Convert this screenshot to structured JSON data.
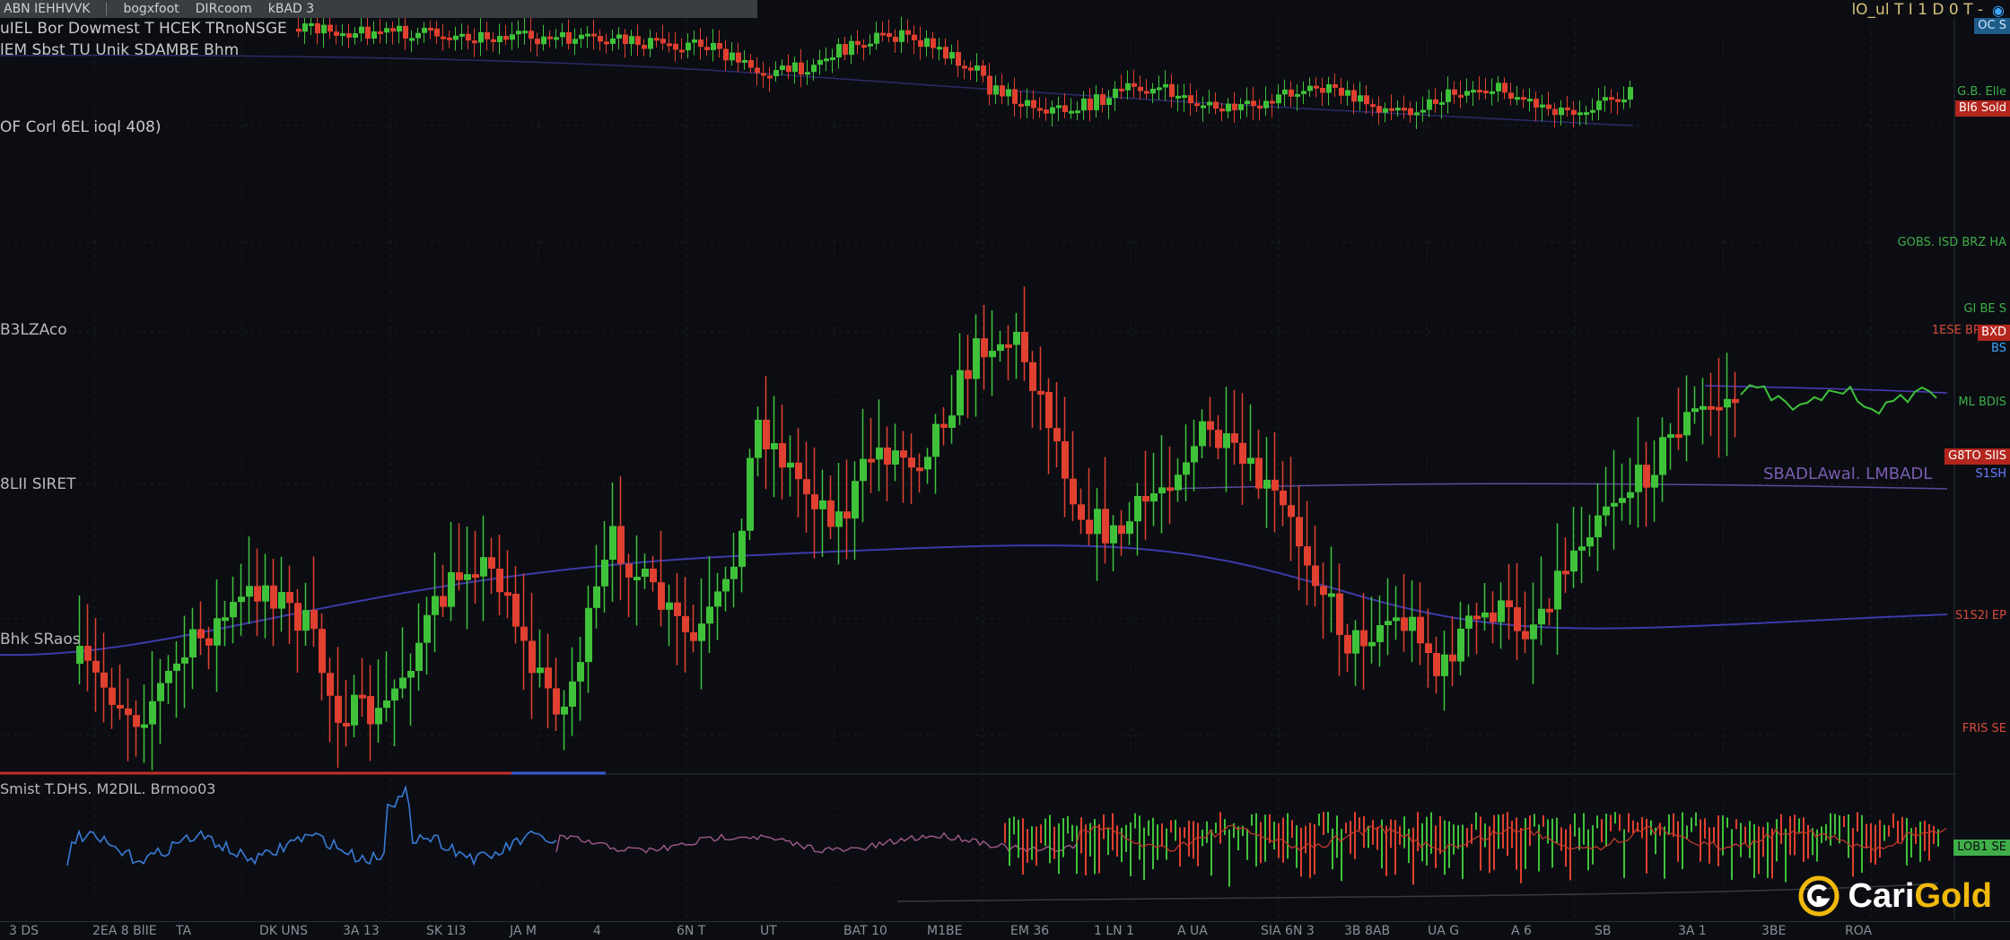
{
  "tabs": [
    "ABN IEHHVVK",
    "bogxfoot",
    "DIRcoom",
    "kBAD 3"
  ],
  "header": {
    "line1": "uIEL Bor Dowmest T HCEK TRnoNSGE",
    "line2": "lEM Sbst TU Unik SDAMBE Bhm",
    "indicator": "OF Corl 6EL ioql 408)"
  },
  "top_right": {
    "text": "lO_ul T I 1 D 0 T -",
    "icon": "camera-icon"
  },
  "left_labels": [
    {
      "id": "l1",
      "text": "B3LZAco"
    },
    {
      "id": "l2",
      "text": "8LII SIRET"
    },
    {
      "id": "l3",
      "text": "Bhk SRaos"
    },
    {
      "id": "l4",
      "text": "Smist T.DHS. M2DIL. Brmoo03"
    }
  ],
  "overlay_label": "SBADLAwal. LMBADL",
  "price_tags": [
    {
      "id": "p1",
      "text": "OC S",
      "bg": "#1e5c8a",
      "fg": "#cfe6ff"
    },
    {
      "id": "p2",
      "text": "G.B. Elle",
      "bg": "",
      "fg": "#3fae49"
    },
    {
      "id": "p3",
      "text": "Bl6 Sold",
      "bg": "#b3261e",
      "fg": "#ffffff"
    },
    {
      "id": "p4",
      "text": "GOBS. ISD BRZ HA",
      "bg": "",
      "fg": "#3fae49"
    },
    {
      "id": "p5",
      "text": "GI BE S",
      "bg": "",
      "fg": "#3fae49"
    },
    {
      "id": "p6",
      "text": "1ESE BP8 Bo",
      "bg": "",
      "fg": "#d84a3a"
    },
    {
      "id": "p7",
      "text": "BXD",
      "bg": "#b3261e",
      "fg": "#ffffff"
    },
    {
      "id": "p8",
      "text": "BS",
      "bg": "",
      "fg": "#3ba6ff"
    },
    {
      "id": "p9",
      "text": "ML BDIS",
      "bg": "",
      "fg": "#3fae49"
    },
    {
      "id": "p10",
      "text": "G8TO SIIS",
      "bg": "#b3261e",
      "fg": "#ffffff"
    },
    {
      "id": "p11",
      "text": "S1SH",
      "bg": "",
      "fg": "#6b7cff"
    },
    {
      "id": "p12",
      "text": "S1S2I EP",
      "bg": "",
      "fg": "#d84a3a"
    },
    {
      "id": "p13",
      "text": "FRIS SE",
      "bg": "",
      "fg": "#d84a3a"
    },
    {
      "id": "p14",
      "text": "LOB1 SE",
      "bg": "#3fae49",
      "fg": "#0b0d12"
    }
  ],
  "x_axis": [
    "3 DS",
    "2EA 8 BlIE",
    "TA",
    "DK UNS",
    "3A 13",
    "SK 1I3",
    "JA M",
    "4",
    "6N T",
    "UT",
    "BAT 10",
    "M1BE",
    "EM 36",
    "1 LN 1",
    "A UA",
    "SIA 6N 3",
    "3B 8AB",
    "UA G",
    "A 6",
    "SB",
    "3A 1",
    "3BE",
    "ROA"
  ],
  "colors": {
    "up": "#3fc23a",
    "down": "#e0402f",
    "background": "#0b0d12",
    "ma": "#4a3fbf"
  },
  "brand": {
    "name_white": "Cari",
    "name_gold": "Gold",
    "icon": "carigold-logo-icon"
  },
  "chart_data": {
    "type": "candlestick",
    "panels": [
      "upper",
      "main",
      "lower"
    ],
    "y_labels": [],
    "note_series": []
  }
}
